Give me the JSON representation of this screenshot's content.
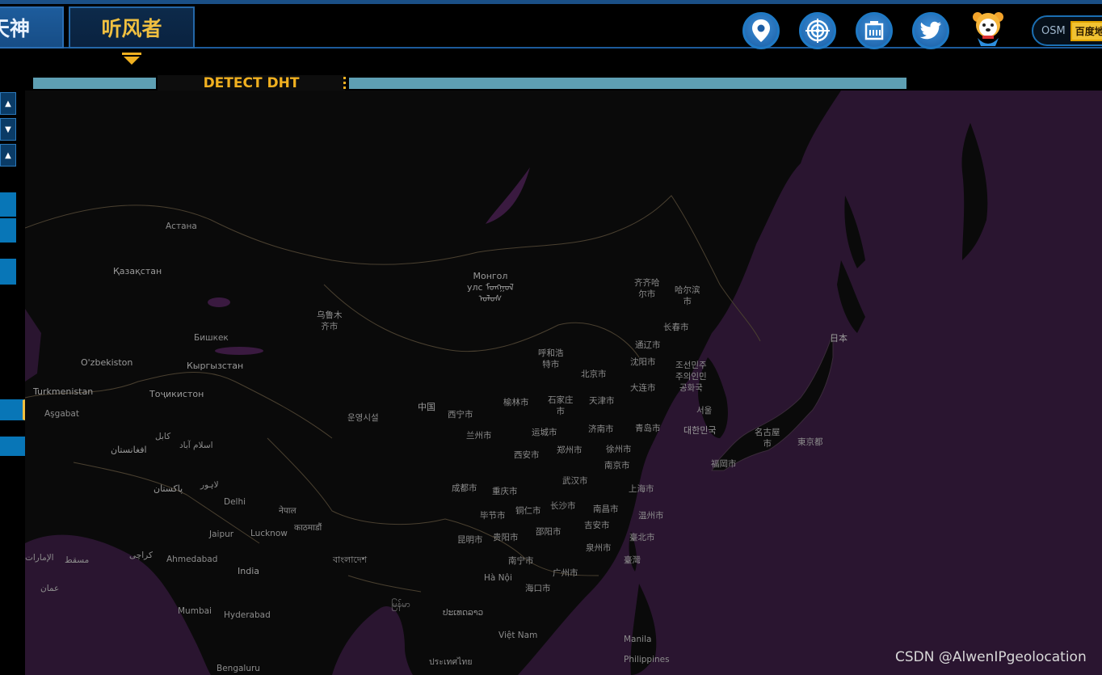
{
  "header": {
    "tab_1": "天神",
    "tab_2": "听风者",
    "icons": [
      "location-pin-icon",
      "target-icon",
      "network-port-icon",
      "twitter-icon"
    ],
    "mascot": "bear-mascot",
    "map_switch": {
      "osm_label": "OSM",
      "baidu_label": "百度地"
    }
  },
  "detect": {
    "label": "DETECT DHT"
  },
  "side_toolbar": [
    "up-arrow-icon",
    "down-arrow-icon",
    "up-arrow-icon"
  ],
  "map": {
    "colors": {
      "land": "#0a0a0a",
      "water": "#2a1530",
      "border": "#4a4030"
    },
    "places": [
      {
        "label": "Астана"
      },
      {
        "label": "Қазақстан"
      },
      {
        "label": "乌鲁木\n齐市"
      },
      {
        "label": "Монгол\nулс ᠮᠣᠩᠭᠣᠯ\nᠤᠯᠤᠰ"
      },
      {
        "label": "齐齐哈\n尔市"
      },
      {
        "label": "哈尔滨\n市"
      },
      {
        "label": "长春市"
      },
      {
        "label": "通辽市"
      },
      {
        "label": "沈阳市"
      },
      {
        "label": "Бишкек"
      },
      {
        "label": "O'zbekiston"
      },
      {
        "label": "Кыргызстан"
      },
      {
        "label": "Turkmenistan"
      },
      {
        "label": "Тоҷикистон"
      },
      {
        "label": "Aşgabat"
      },
      {
        "label": "呼和浩\n特市"
      },
      {
        "label": "北京市"
      },
      {
        "label": "조선민주\n주의인민\n공화국"
      },
      {
        "label": "日本"
      },
      {
        "label": "大连市"
      },
      {
        "label": "中国"
      },
      {
        "label": "西宁市"
      },
      {
        "label": "榆林市"
      },
      {
        "label": "石家庄\n市"
      },
      {
        "label": "天津市"
      },
      {
        "label": "서울"
      },
      {
        "label": "兰州市"
      },
      {
        "label": "운영시설"
      },
      {
        "label": "济南市"
      },
      {
        "label": "青岛市"
      },
      {
        "label": "대한민국"
      },
      {
        "label": "名古屋\n市"
      },
      {
        "label": "東京都"
      },
      {
        "label": "运城市"
      },
      {
        "label": "郑州市"
      },
      {
        "label": "西安市"
      },
      {
        "label": "徐州市"
      },
      {
        "label": "南京市"
      },
      {
        "label": "福岡市"
      },
      {
        "label": "کابل"
      },
      {
        "label": "اسلام آباد"
      },
      {
        "label": "افغانستان"
      },
      {
        "label": "لاہور"
      },
      {
        "label": "پاکستان"
      },
      {
        "label": "成都市"
      },
      {
        "label": "重庆市"
      },
      {
        "label": "武汉市"
      },
      {
        "label": "上海市"
      },
      {
        "label": "Delhi"
      },
      {
        "label": "नेपाल"
      },
      {
        "label": "काठमाडौं"
      },
      {
        "label": "毕节市"
      },
      {
        "label": "铜仁市"
      },
      {
        "label": "长沙市"
      },
      {
        "label": "南昌市"
      },
      {
        "label": "温州市"
      },
      {
        "label": "Jaipur"
      },
      {
        "label": "Lucknow"
      },
      {
        "label": "昆明市"
      },
      {
        "label": "贵阳市"
      },
      {
        "label": "邵阳市"
      },
      {
        "label": "吉安市"
      },
      {
        "label": "臺北市"
      },
      {
        "label": "泉州市"
      },
      {
        "label": "臺灣"
      },
      {
        "label": "مسقط"
      },
      {
        "label": "کراچی"
      },
      {
        "label": "Ahmedabad"
      },
      {
        "label": "বাংলাদেশ"
      },
      {
        "label": "南宁市"
      },
      {
        "label": "广州市"
      },
      {
        "label": "عمان"
      },
      {
        "label": "India"
      },
      {
        "label": "Hà Nội"
      },
      {
        "label": "海口市"
      },
      {
        "label": "Mumbai"
      },
      {
        "label": "Hyderabad"
      },
      {
        "label": "မြန်မာ"
      },
      {
        "label": "ประเทศไทย"
      },
      {
        "label": "Việt Nam"
      },
      {
        "label": "Manila"
      },
      {
        "label": "Philippines"
      },
      {
        "label": "Bengaluru"
      },
      {
        "label": "ປະເທດລາວ"
      },
      {
        "label": "الإمارات"
      }
    ]
  },
  "watermark": "CSDN @AlwenIPgeolocation"
}
